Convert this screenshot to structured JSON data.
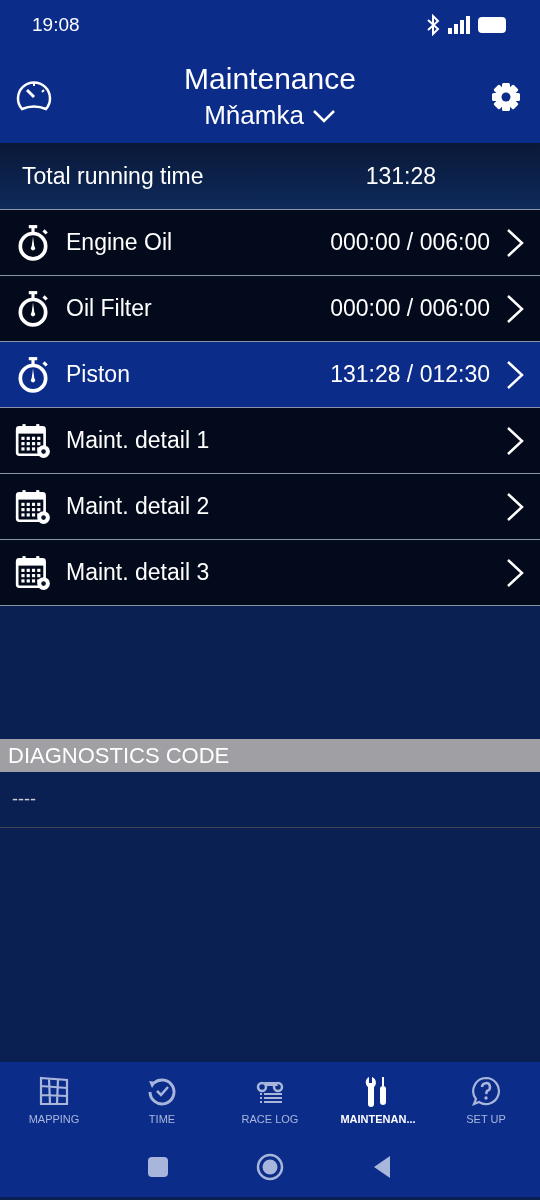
{
  "status_bar": {
    "time": "19:08"
  },
  "header": {
    "title": "Maintenance",
    "profile": "Mňamka"
  },
  "total": {
    "label": "Total running time",
    "value": "131:28"
  },
  "items": [
    {
      "kind": "timer",
      "label": "Engine Oil",
      "value": "000:00 / 006:00",
      "selected": false
    },
    {
      "kind": "timer",
      "label": "Oil Filter",
      "value": "000:00 / 006:00",
      "selected": false
    },
    {
      "kind": "timer",
      "label": "Piston",
      "value": "131:28 / 012:30",
      "selected": true
    },
    {
      "kind": "calendar",
      "label": "Maint. detail 1",
      "selected": false
    },
    {
      "kind": "calendar",
      "label": "Maint. detail 2",
      "selected": false
    },
    {
      "kind": "calendar",
      "label": "Maint. detail 3",
      "selected": false
    }
  ],
  "diagnostics": {
    "title": "DIAGNOSTICS CODE",
    "code": "----"
  },
  "tabs": [
    {
      "kind": "map",
      "label": "MAPPING",
      "selected": false
    },
    {
      "kind": "time",
      "label": "TIME",
      "selected": false
    },
    {
      "kind": "log",
      "label": "RACE LOG",
      "selected": false
    },
    {
      "kind": "tools",
      "label": "MAINTENAN...",
      "selected": true
    },
    {
      "kind": "help",
      "label": "SET UP",
      "selected": false
    }
  ]
}
